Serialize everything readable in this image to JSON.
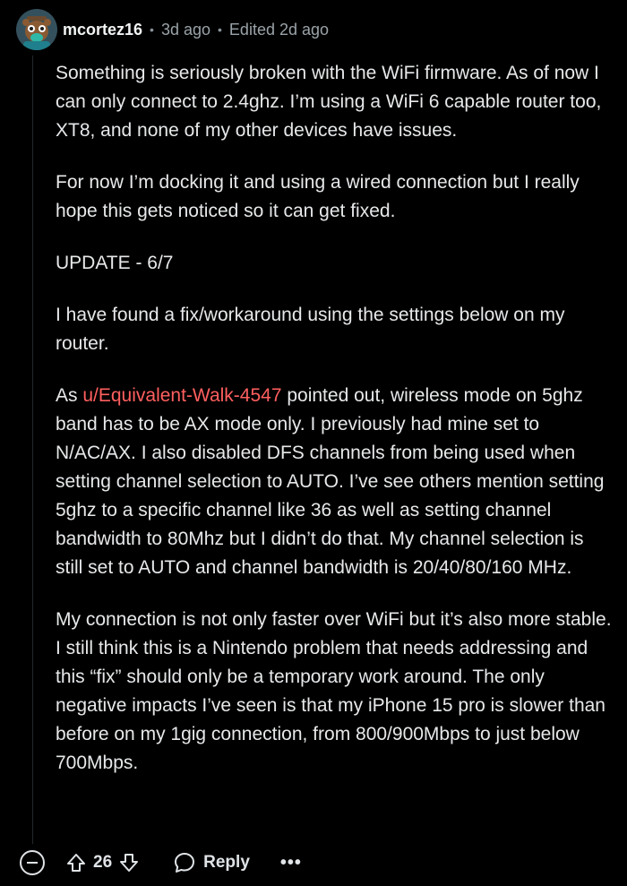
{
  "comment": {
    "author": "mcortez16",
    "age": "3d ago",
    "edited": "Edited 2d ago",
    "separator": "•",
    "avatar_icon": "snoo-avatar-icon",
    "link_color": "#ff5f5f",
    "body": {
      "p1": "Something is seriously broken with the WiFi firmware. As of now I can only connect to 2.4ghz. I’m using a WiFi 6 capable router too, XT8, and none of my other devices have issues.",
      "p2": "For now I’m docking it and using a wired connection but I really hope this gets noticed so it can get fixed.",
      "p3": "UPDATE - 6/7",
      "p4": "I have found a fix/workaround using the settings below on my router.",
      "p5_prefix": "As ",
      "p5_link": "u/Equivalent-Walk-4547",
      "p5_rest": " pointed out, wireless mode on 5ghz band has to be AX mode only. I previously had mine set to N/AC/AX. I also disabled DFS channels from being used when setting channel selection to AUTO. I’ve see others mention setting 5ghz to a specific channel like 36 as well as setting channel bandwidth to 80Mhz but I didn’t do that. My channel selection is still set to AUTO and channel bandwidth is 20/40/80/160 MHz.",
      "p6": "My connection is not only faster over WiFi but it’s also more stable. I still think this is a Nintendo problem that needs addressing and this “fix” should only be a temporary work around. The only negative impacts I’ve seen is that my iPhone 15 pro is slower than before on my 1gig connection, from 800/900Mbps to just below 700Mbps."
    },
    "actions": {
      "score": "26",
      "reply_label": "Reply",
      "more_label": "•••",
      "collapse_icon": "collapse-minus-icon",
      "upvote_icon": "upvote-arrow-icon",
      "downvote_icon": "downvote-arrow-icon",
      "reply_icon": "speech-bubble-icon"
    }
  }
}
